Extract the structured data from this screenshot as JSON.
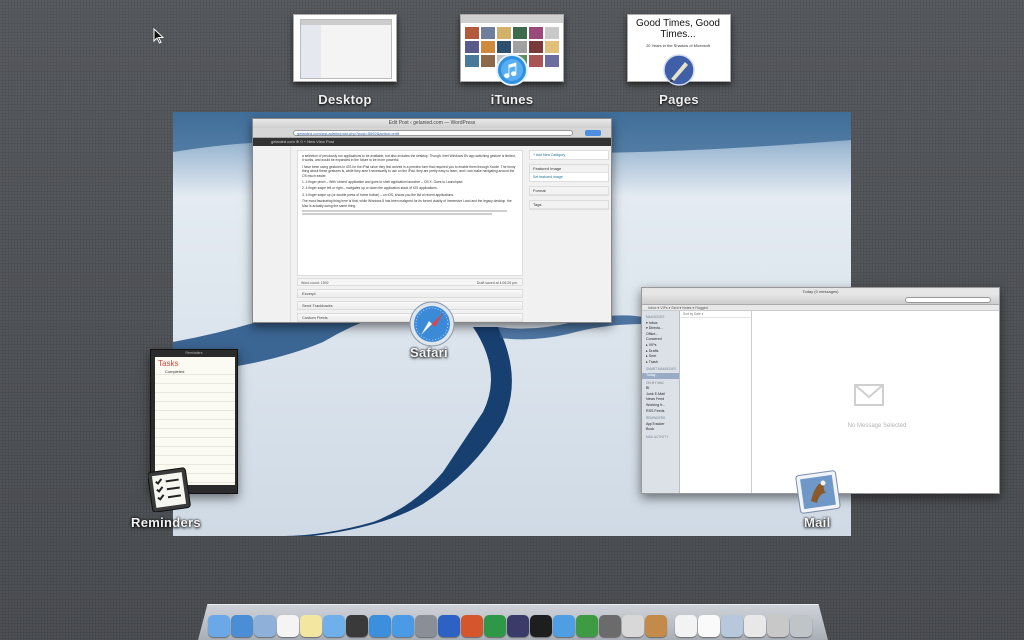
{
  "spaces": {
    "items": [
      {
        "label": "Desktop"
      },
      {
        "label": "iTunes"
      },
      {
        "label": "Pages"
      }
    ],
    "pages_preview": {
      "title": "Good Times, Good Times...",
      "subtitle": "20 Years in the Shadow of Microsoft"
    }
  },
  "windows": {
    "safari": {
      "app_label": "Safari",
      "title": "Edit Post ‹ gelanied.com — WordPress",
      "url": "gelanied.com/wp-admin/post.php?post=5592&action=edit",
      "admin_bar": "gelanied.com   ⊕ 0   + New   View Post",
      "paragraphs": [
        "a selection of previously run applications to be available, but also includes the desktop. Though I feel Windows 8's app switching gesture is limited, it works, and would be expanded in the future to be more powerful.",
        "I have been using gestures in iOS for the iPad since they first arrived in a preview form that required you to enable them through Xcode. The funny thing about these gestures is, while they aren't necessarily to use on the iPad, they are pretty easy to learn, and I can make navigating around the OS much easier.",
        "1. 4 finger pinch – With 'closed' application and goes to shell application launcher – OS X: Goes to Launchpad",
        "2. 4 finger swipe left or right – navigates up or down the application stack of iOS applications.",
        "3. 4 finger swipe up (or double press of home button) – on iOS, shows you the list of recent applications.",
        "The most fascinating thing here is that, while Windows 8 has been maligned for its forced duality of Immersive Land and the legacy desktop, the Mac is actually doing the same thing."
      ],
      "word_count": "Word count: 1592",
      "draft_saved": "Draft saved at 4:06:26 pm.",
      "boxes": [
        "Excerpt",
        "Send Trackbacks",
        "Custom Fields"
      ],
      "sidebar_boxes": [
        {
          "title": "+ Add New Category",
          "content": ""
        },
        {
          "title": "Featured Image",
          "content": "Set featured image"
        },
        {
          "title": "Format",
          "content": ""
        },
        {
          "title": "Tags",
          "content": ""
        }
      ]
    },
    "mail": {
      "app_label": "Mail",
      "title": "Today (0 messages)",
      "favorites_bar": "Inbox ▾   VIPs ▾   Sent ▾   Notes ▾   Flagged",
      "sort_label": "Sort by Date ▾",
      "sidebar": [
        {
          "text": "MAILBOXES",
          "type": "sec"
        },
        {
          "text": "▾ Inbox",
          "type": "item"
        },
        {
          "text": "   ▾ Directo...",
          "type": "item"
        },
        {
          "text": "      Office...",
          "type": "item"
        },
        {
          "text": "   Concered",
          "type": "item"
        },
        {
          "text": "▸ VIPs",
          "type": "item"
        },
        {
          "text": "▸ Drafts",
          "type": "item"
        },
        {
          "text": "▸ Sent",
          "type": "item"
        },
        {
          "text": "▸ Trash",
          "type": "item"
        },
        {
          "text": "SMART MAILBOXES",
          "type": "sec"
        },
        {
          "text": "  Today",
          "type": "sel"
        },
        {
          "text": "ON MY MAC",
          "type": "sec"
        },
        {
          "text": "  BI",
          "type": "item"
        },
        {
          "text": "  Junk E-Mail",
          "type": "item"
        },
        {
          "text": "  News Feed",
          "type": "item"
        },
        {
          "text": "  Working fr...",
          "type": "item"
        },
        {
          "text": "  RSS Feeds",
          "type": "item"
        },
        {
          "text": "REMINDERS",
          "type": "sec"
        },
        {
          "text": "  AppTracker",
          "type": "item"
        },
        {
          "text": "  Book",
          "type": "item"
        },
        {
          "text": "MAIL ACTIVITY",
          "type": "sec"
        }
      ],
      "no_selection": "No Message Selected"
    },
    "reminders": {
      "app_label": "Reminders",
      "title": "Reminders",
      "list_title": "Tasks",
      "item": "Completed"
    }
  },
  "dock": {
    "icons": [
      {
        "name": "finder-icon",
        "color": "#6aa8e8"
      },
      {
        "name": "safari-icon",
        "color": "#4a8fd6"
      },
      {
        "name": "mail-icon",
        "color": "#8fb0d8"
      },
      {
        "name": "calendar-icon",
        "color": "#f4f4f4"
      },
      {
        "name": "notes-icon",
        "color": "#f2e6a0"
      },
      {
        "name": "messages-icon",
        "color": "#6fb0ea"
      },
      {
        "name": "facetime-icon",
        "color": "#3a3a3a"
      },
      {
        "name": "itunes-icon",
        "color": "#3c8fdc"
      },
      {
        "name": "app-store-icon",
        "color": "#4b9ae6"
      },
      {
        "name": "system-preferences-icon",
        "color": "#8a8f97"
      },
      {
        "name": "word-icon",
        "color": "#2d62c4"
      },
      {
        "name": "powerpoint-icon",
        "color": "#d5552c"
      },
      {
        "name": "excel-icon",
        "color": "#2f9848"
      },
      {
        "name": "pen-icon",
        "color": "#3b3b6a"
      },
      {
        "name": "skype-icon",
        "color": "#1e1e1e"
      },
      {
        "name": "cloud-icon",
        "color": "#4e9ee4"
      },
      {
        "name": "evernote-icon",
        "color": "#3f9a44"
      },
      {
        "name": "utility-icon",
        "color": "#6b6b6b"
      },
      {
        "name": "cloud-app-icon",
        "color": "#d8d8d8"
      },
      {
        "name": "photo-icon",
        "color": "#c48a4a"
      },
      {
        "name": "pages-icon",
        "color": "#f3f3f3"
      },
      {
        "name": "document-icon",
        "color": "#fafafa"
      },
      {
        "name": "preview-icon",
        "color": "#b8c8dc"
      },
      {
        "name": "printer-icon",
        "color": "#e8e8e8"
      },
      {
        "name": "folder-icon",
        "color": "#c8c8c8"
      },
      {
        "name": "trash-icon",
        "color": "#bfc4c9"
      }
    ]
  },
  "colors": {
    "background": "#4a4d52",
    "reminders_accent": "#d0463c",
    "link": "#21759b"
  }
}
